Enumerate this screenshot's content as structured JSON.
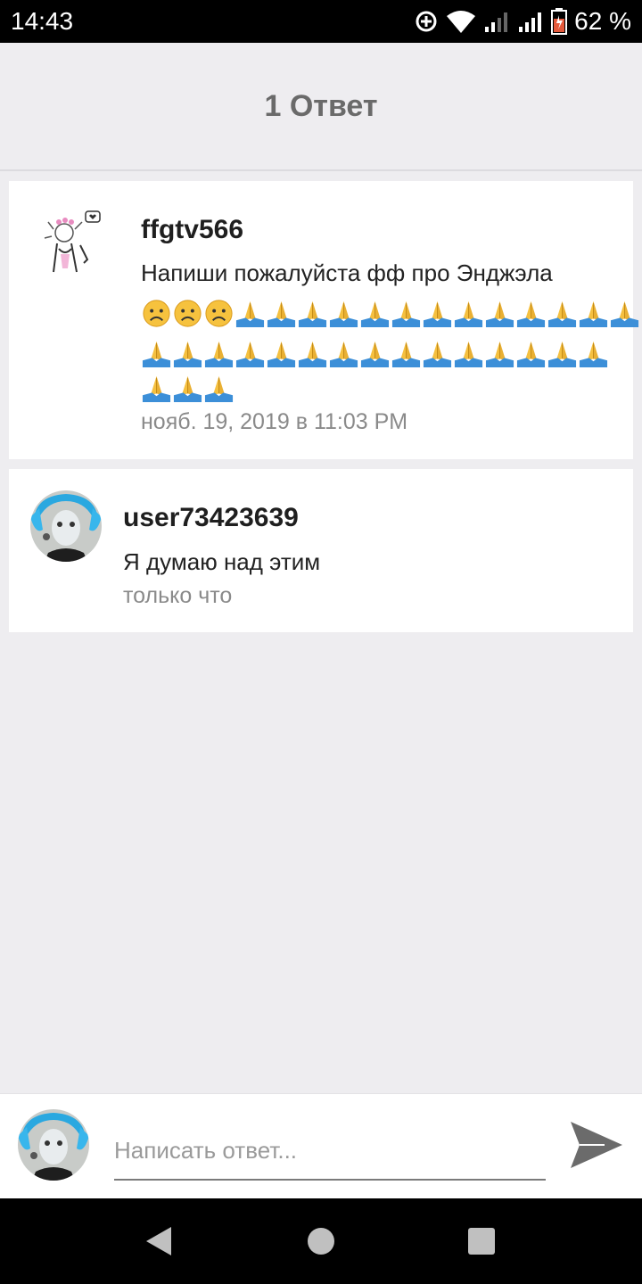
{
  "status_bar": {
    "time": "14:43",
    "battery": "62 %"
  },
  "header": {
    "title": "1 Ответ"
  },
  "original_comment": {
    "username": "ffgtv566",
    "text": "Напиши пожалуйста фф про Энджэла",
    "emoji_rows": [
      [
        "frown",
        "frown",
        "frown",
        "pray",
        "pray",
        "pray",
        "pray",
        "pray",
        "pray",
        "pray",
        "pray",
        "pray",
        "pray",
        "pray",
        "pray",
        "pray"
      ],
      [
        "pray",
        "pray",
        "pray",
        "pray",
        "pray",
        "pray",
        "pray",
        "pray",
        "pray",
        "pray",
        "pray",
        "pray",
        "pray",
        "pray",
        "pray"
      ],
      [
        "pray",
        "pray",
        "pray"
      ]
    ],
    "time": "нояб. 19, 2019 в 11:03 PM"
  },
  "reply": {
    "username": "user73423639",
    "text": "Я думаю над этим",
    "time": "только что"
  },
  "reply_input": {
    "placeholder": "Написать ответ..."
  },
  "colors": {
    "background": "#eeedf0",
    "card": "#ffffff",
    "username": "#1f1f1f",
    "meta": "#8a8a8a",
    "send_icon": "#6b6b6b"
  }
}
